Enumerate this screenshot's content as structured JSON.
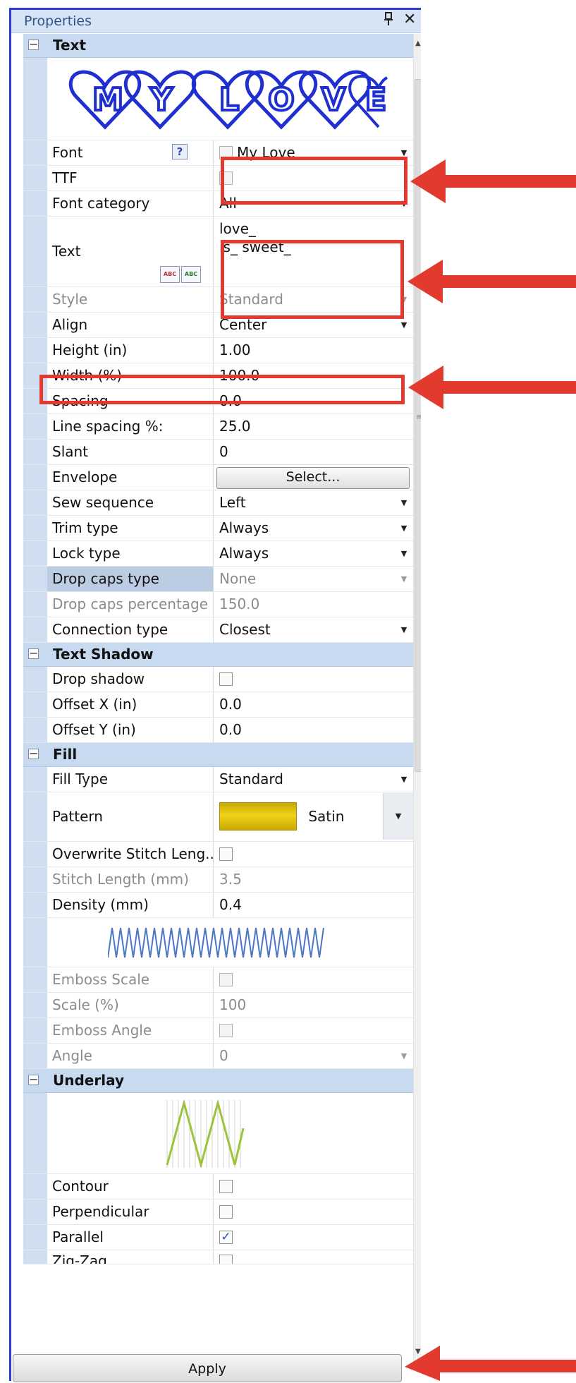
{
  "panel": {
    "title": "Properties",
    "pin_glyph": "📌",
    "close_glyph": "✕",
    "apply_label": "Apply"
  },
  "icons": {
    "collapse": "−",
    "checkmark": "✓",
    "dropdown": "▼",
    "help": "?"
  },
  "colors": {
    "accent_border": "#2b3dd6",
    "category_bg": "#c8daf0",
    "annotation_red": "#e23a2e",
    "pattern_gold": "#d6b400",
    "font_preview_blue": "#1f2fd0"
  },
  "sections": {
    "text": {
      "title": "Text",
      "preview_text": "MY LOVE",
      "font": {
        "label": "Font",
        "value": "My Love"
      },
      "ttf": {
        "label": "TTF",
        "checked": false
      },
      "font_category": {
        "label": "Font category",
        "value": "All"
      },
      "text_field": {
        "label": "Text",
        "line1": "love_",
        "line2": "is_ sweet_",
        "abc_label": "ABC",
        "spell_label": "ABC"
      },
      "style": {
        "label": "Style",
        "value": "Standard"
      },
      "align": {
        "label": "Align",
        "value": "Center"
      },
      "height": {
        "label": "Height (in)",
        "value": "1.00"
      },
      "width": {
        "label": "Width (%)",
        "value": "100.0"
      },
      "spacing": {
        "label": "Spacing",
        "value": "0.0"
      },
      "line_spacing": {
        "label": "Line spacing %:",
        "value": "25.0"
      },
      "slant": {
        "label": "Slant",
        "value": "0"
      },
      "envelope": {
        "label": "Envelope",
        "button": "Select..."
      },
      "sew_sequence": {
        "label": "Sew sequence",
        "value": "Left"
      },
      "trim_type": {
        "label": "Trim type",
        "value": "Always"
      },
      "lock_type": {
        "label": "Lock type",
        "value": "Always"
      },
      "drop_caps_type": {
        "label": "Drop caps type",
        "value": "None"
      },
      "drop_caps_pct": {
        "label": "Drop caps percentage",
        "value": "150.0"
      },
      "connection_type": {
        "label": "Connection type",
        "value": "Closest"
      }
    },
    "text_shadow": {
      "title": "Text Shadow",
      "drop_shadow": {
        "label": "Drop shadow",
        "checked": false
      },
      "offset_x": {
        "label": "Offset X (in)",
        "value": "0.0"
      },
      "offset_y": {
        "label": "Offset Y (in)",
        "value": "0.0"
      }
    },
    "fill": {
      "title": "Fill",
      "fill_type": {
        "label": "Fill Type",
        "value": "Standard"
      },
      "pattern": {
        "label": "Pattern",
        "value": "Satin"
      },
      "overwrite_stitch": {
        "label": "Overwrite Stitch Leng...",
        "checked": false
      },
      "stitch_length": {
        "label": "Stitch Length (mm)",
        "value": "3.5"
      },
      "density": {
        "label": "Density (mm)",
        "value": "0.4"
      },
      "emboss_scale": {
        "label": "Emboss Scale",
        "checked": false
      },
      "scale": {
        "label": "Scale (%)",
        "value": "100"
      },
      "emboss_angle": {
        "label": "Emboss Angle",
        "checked": false
      },
      "angle": {
        "label": "Angle",
        "value": "0"
      }
    },
    "underlay": {
      "title": "Underlay",
      "contour": {
        "label": "Contour",
        "checked": false
      },
      "perpendicular": {
        "label": "Perpendicular",
        "checked": false
      },
      "parallel": {
        "label": "Parallel",
        "checked": true
      },
      "zigzag": {
        "label": "Zig-Zag",
        "checked": false
      }
    }
  }
}
